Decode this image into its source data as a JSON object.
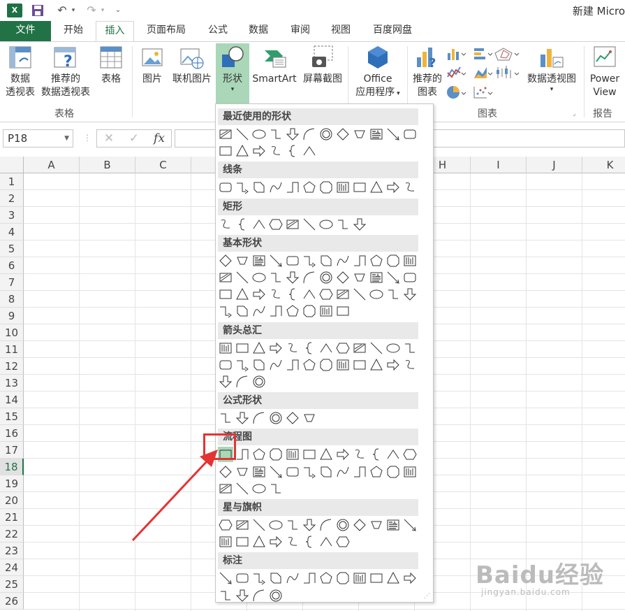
{
  "window": {
    "title": "新建 Micro"
  },
  "tabs": [
    "文件",
    "开始",
    "插入",
    "页面布局",
    "公式",
    "数据",
    "审阅",
    "视图",
    "百度网盘"
  ],
  "ribbon": {
    "pivot_table": [
      "数据",
      "透视表"
    ],
    "recommended_pivot": [
      "推荐的",
      "数据透视表"
    ],
    "table": "表格",
    "picture": "图片",
    "online_picture": "联机图片",
    "shapes": "形状",
    "smartart": "SmartArt",
    "screenshot": "屏幕截图",
    "office": [
      "Office",
      "应用程序"
    ],
    "recommended_charts": [
      "推荐的",
      "图表"
    ],
    "pivot_chart": "数据透视图",
    "power_view": [
      "Power",
      "View"
    ],
    "group_tables": "表格",
    "group_charts": "图表",
    "group_report": "报告"
  },
  "formula_bar": {
    "name_box": "P18",
    "fx": "fx",
    "cancel": "✕",
    "enter": "✓"
  },
  "grid": {
    "columns": [
      "A",
      "B",
      "C",
      "D",
      "E",
      "F",
      "G",
      "H",
      "I",
      "J",
      "K"
    ],
    "rows": [
      "1",
      "2",
      "3",
      "4",
      "5",
      "6",
      "7",
      "8",
      "9",
      "10",
      "11",
      "12",
      "13",
      "14",
      "15",
      "16",
      "17",
      "18",
      "19",
      "20",
      "21",
      "22",
      "23",
      "24",
      "25",
      "26"
    ],
    "selected_row": "18"
  },
  "shapes_menu": {
    "sections": [
      {
        "title": "最近使用的形状",
        "rows": [
          12,
          6
        ]
      },
      {
        "title": "线条",
        "rows": [
          12
        ]
      },
      {
        "title": "矩形",
        "rows": [
          9
        ]
      },
      {
        "title": "基本形状",
        "rows": [
          12,
          12,
          12,
          8
        ]
      },
      {
        "title": "箭头总汇",
        "rows": [
          12,
          12,
          3
        ]
      },
      {
        "title": "公式形状",
        "rows": [
          6
        ]
      },
      {
        "title": "流程图",
        "rows": [
          12,
          12,
          4
        ]
      },
      {
        "title": "星与旗帜",
        "rows": [
          12,
          8
        ]
      },
      {
        "title": "标注",
        "rows": [
          12,
          4
        ]
      }
    ]
  },
  "watermark": {
    "main": "Baidu经验",
    "sub": "jingyan.baidu.com"
  },
  "colors": {
    "excel_green": "#217346",
    "shapes_highlight": "#a9d7b8",
    "annotation_red": "#e53333"
  }
}
